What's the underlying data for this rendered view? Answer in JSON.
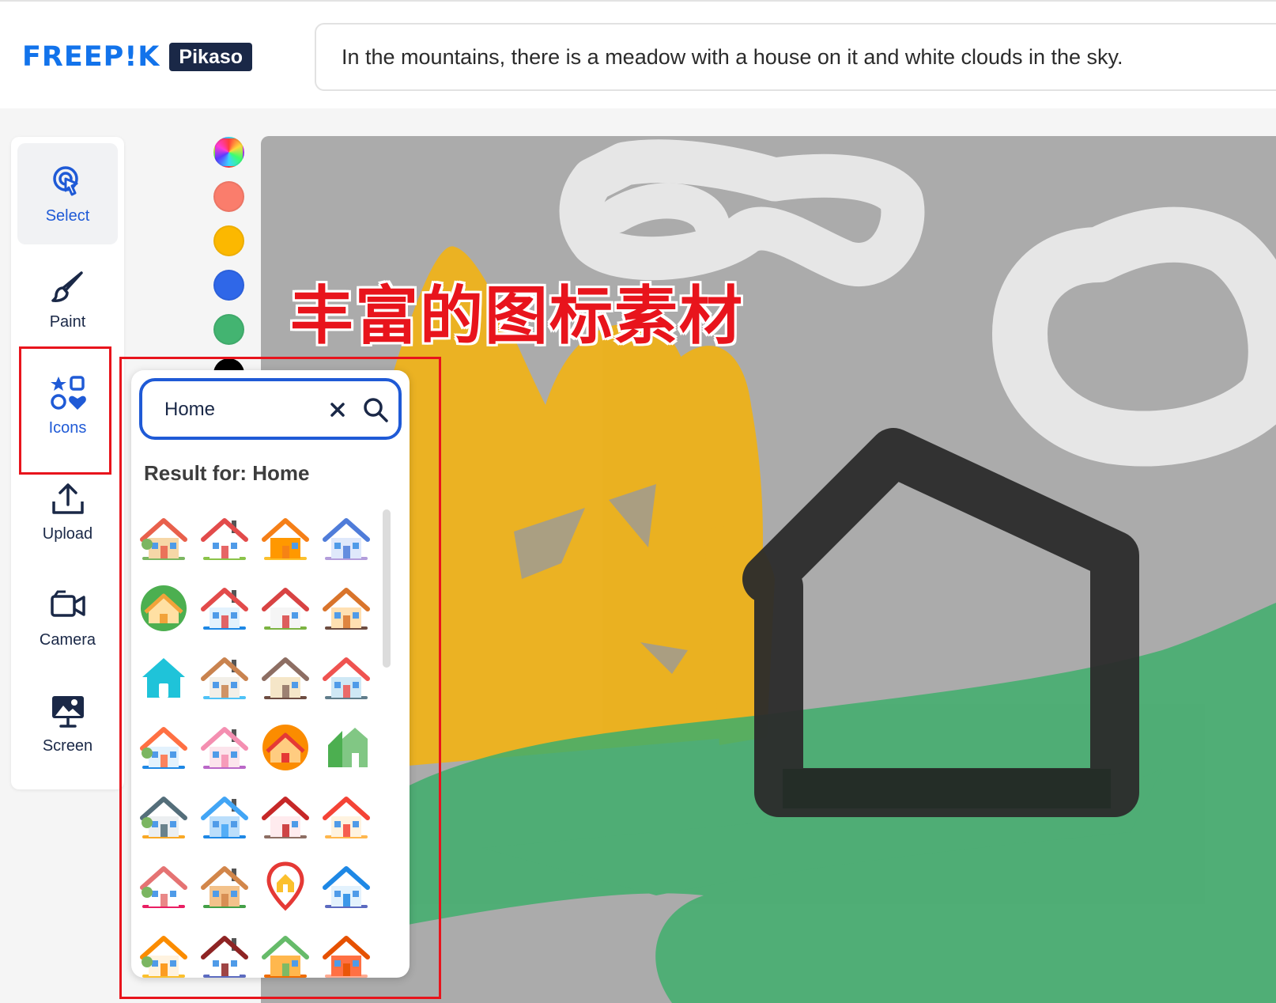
{
  "header": {
    "logo_word": "FREEP!K",
    "logo_badge": "Pikaso",
    "prompt": "In the mountains, there is a meadow with a house on it and white clouds in the sky."
  },
  "tools": [
    {
      "label": "Select",
      "icon": "select-pointer-icon",
      "active": true
    },
    {
      "label": "Paint",
      "icon": "paintbrush-icon",
      "active": false
    },
    {
      "label": "Icons",
      "icon": "shapes-icon",
      "active": false
    },
    {
      "label": "Upload",
      "icon": "upload-icon",
      "active": false
    },
    {
      "label": "Camera",
      "icon": "video-camera-icon",
      "active": false
    },
    {
      "label": "Screen",
      "icon": "screen-share-icon",
      "active": false
    }
  ],
  "colors": {
    "swatches": [
      "rainbow",
      "#fa7d6c",
      "#fcb800",
      "#2f67e8",
      "#43b471",
      "#000000"
    ],
    "accent": "#1f5ad6",
    "annotation_red": "#e8141c"
  },
  "annotation": "丰富的图标素材",
  "icon_panel": {
    "search_value": "Home",
    "clear_icon": "close-icon",
    "search_icon": "search-icon",
    "result_label": "Result for: Home",
    "icons": [
      "house-trees-icon",
      "red-roof-house-icon",
      "orange-house-icon",
      "blue-house-icon",
      "round-house-badge-icon",
      "red-chimney-house-icon",
      "house-tree-icon",
      "two-story-house-icon",
      "cyan-home-icon",
      "wifi-house-icon",
      "cottage-icon",
      "smart-house-icon",
      "smart-home-phone-icon",
      "living-room-icon",
      "round-house-icon",
      "green-houses-icon",
      "street-houses-icon",
      "blue-outline-house-icon",
      "fenced-house-icon",
      "hand-house-icon",
      "heart-house-icon",
      "gingerbread-house-icon",
      "location-pin-house-icon",
      "blue-3d-house-icon",
      "money-house-icon",
      "family-house-icon",
      "plants-blocks-icon",
      "orange-roof-icon"
    ]
  }
}
